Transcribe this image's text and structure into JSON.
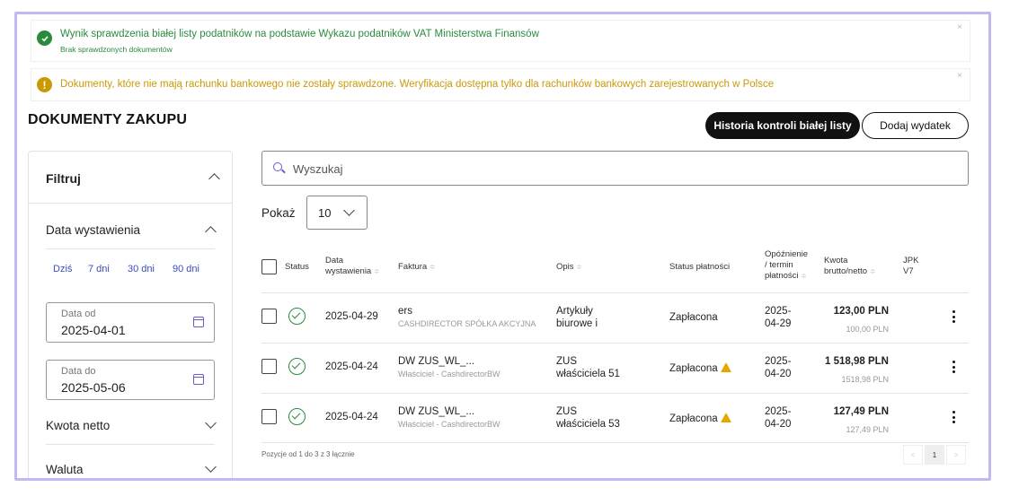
{
  "alerts": {
    "success_title": "Wynik sprawdzenia białej listy podatników na podstawie Wykazu podatników VAT Ministerstwa Finansów",
    "success_sub": "Brak sprawdzonych dokumentów",
    "warning_text": "Dokumenty, które nie mają rachunku bankowego nie zostały sprawdzone. Weryfikacja dostępna tylko dla rachunków bankowych zarejestrowanych w Polsce",
    "close": "×"
  },
  "page": {
    "title": "DOKUMENTY ZAKUPU",
    "history_button": "Historia kontroli białej listy",
    "add_button": "Dodaj wydatek"
  },
  "filter": {
    "title": "Filtruj",
    "date_section": "Data wystawienia",
    "quick": [
      "Dziś",
      "7 dni",
      "30 dni",
      "90 dni"
    ],
    "date_from_label": "Data od",
    "date_from_value": "2025-04-01",
    "date_to_label": "Data do",
    "date_to_value": "2025-05-06",
    "net_section": "Kwota netto",
    "currency_section": "Waluta"
  },
  "search": {
    "placeholder": "Wyszukaj"
  },
  "pager": {
    "show_label": "Pokaż",
    "page_size": "10",
    "summary": "Pozycje od 1 do 3 z 3 łącznie",
    "prev": "<",
    "current": "1",
    "next": ">"
  },
  "table": {
    "headers": {
      "status": "Status",
      "date_l1": "Data",
      "date_l2": "wystawienia",
      "invoice": "Faktura",
      "desc": "Opis",
      "payment": "Status płatności",
      "delay_l1": "Opóźnienie",
      "delay_l2": "/ termin",
      "delay_l3": "płatności",
      "amount_l1": "Kwota",
      "amount_l2": "brutto/netto",
      "jpk_l1": "JPK",
      "jpk_l2": "V7",
      "sort": "≑"
    },
    "rows": [
      {
        "date": "2025-04-29",
        "invoice": "ers",
        "contractor": "CASHDIRECTOR SPÓŁKA AKCYJNA",
        "desc_l1": "Artykuły",
        "desc_l2": "biurowe i",
        "payment": "Zapłacona",
        "due_l1": "2025-",
        "due_l2": "04-29",
        "gross": "123,00 PLN",
        "net": "100,00 PLN",
        "warning": false
      },
      {
        "date": "2025-04-24",
        "invoice": "DW ZUS_WL_...",
        "contractor": "Właściciel - CashdirectorBW",
        "desc_l1": "ZUS",
        "desc_l2": "właściciela 51",
        "payment": "Zapłacona",
        "due_l1": "2025-",
        "due_l2": "04-20",
        "gross": "1 518,98 PLN",
        "net": "1518,98 PLN",
        "warning": true
      },
      {
        "date": "2025-04-24",
        "invoice": "DW ZUS_WL_...",
        "contractor": "Właściciel - CashdirectorBW",
        "desc_l1": "ZUS",
        "desc_l2": "właściciela 53",
        "payment": "Zapłacona",
        "due_l1": "2025-",
        "due_l2": "04-20",
        "gross": "127,49 PLN",
        "net": "127,49 PLN",
        "warning": true
      }
    ]
  }
}
